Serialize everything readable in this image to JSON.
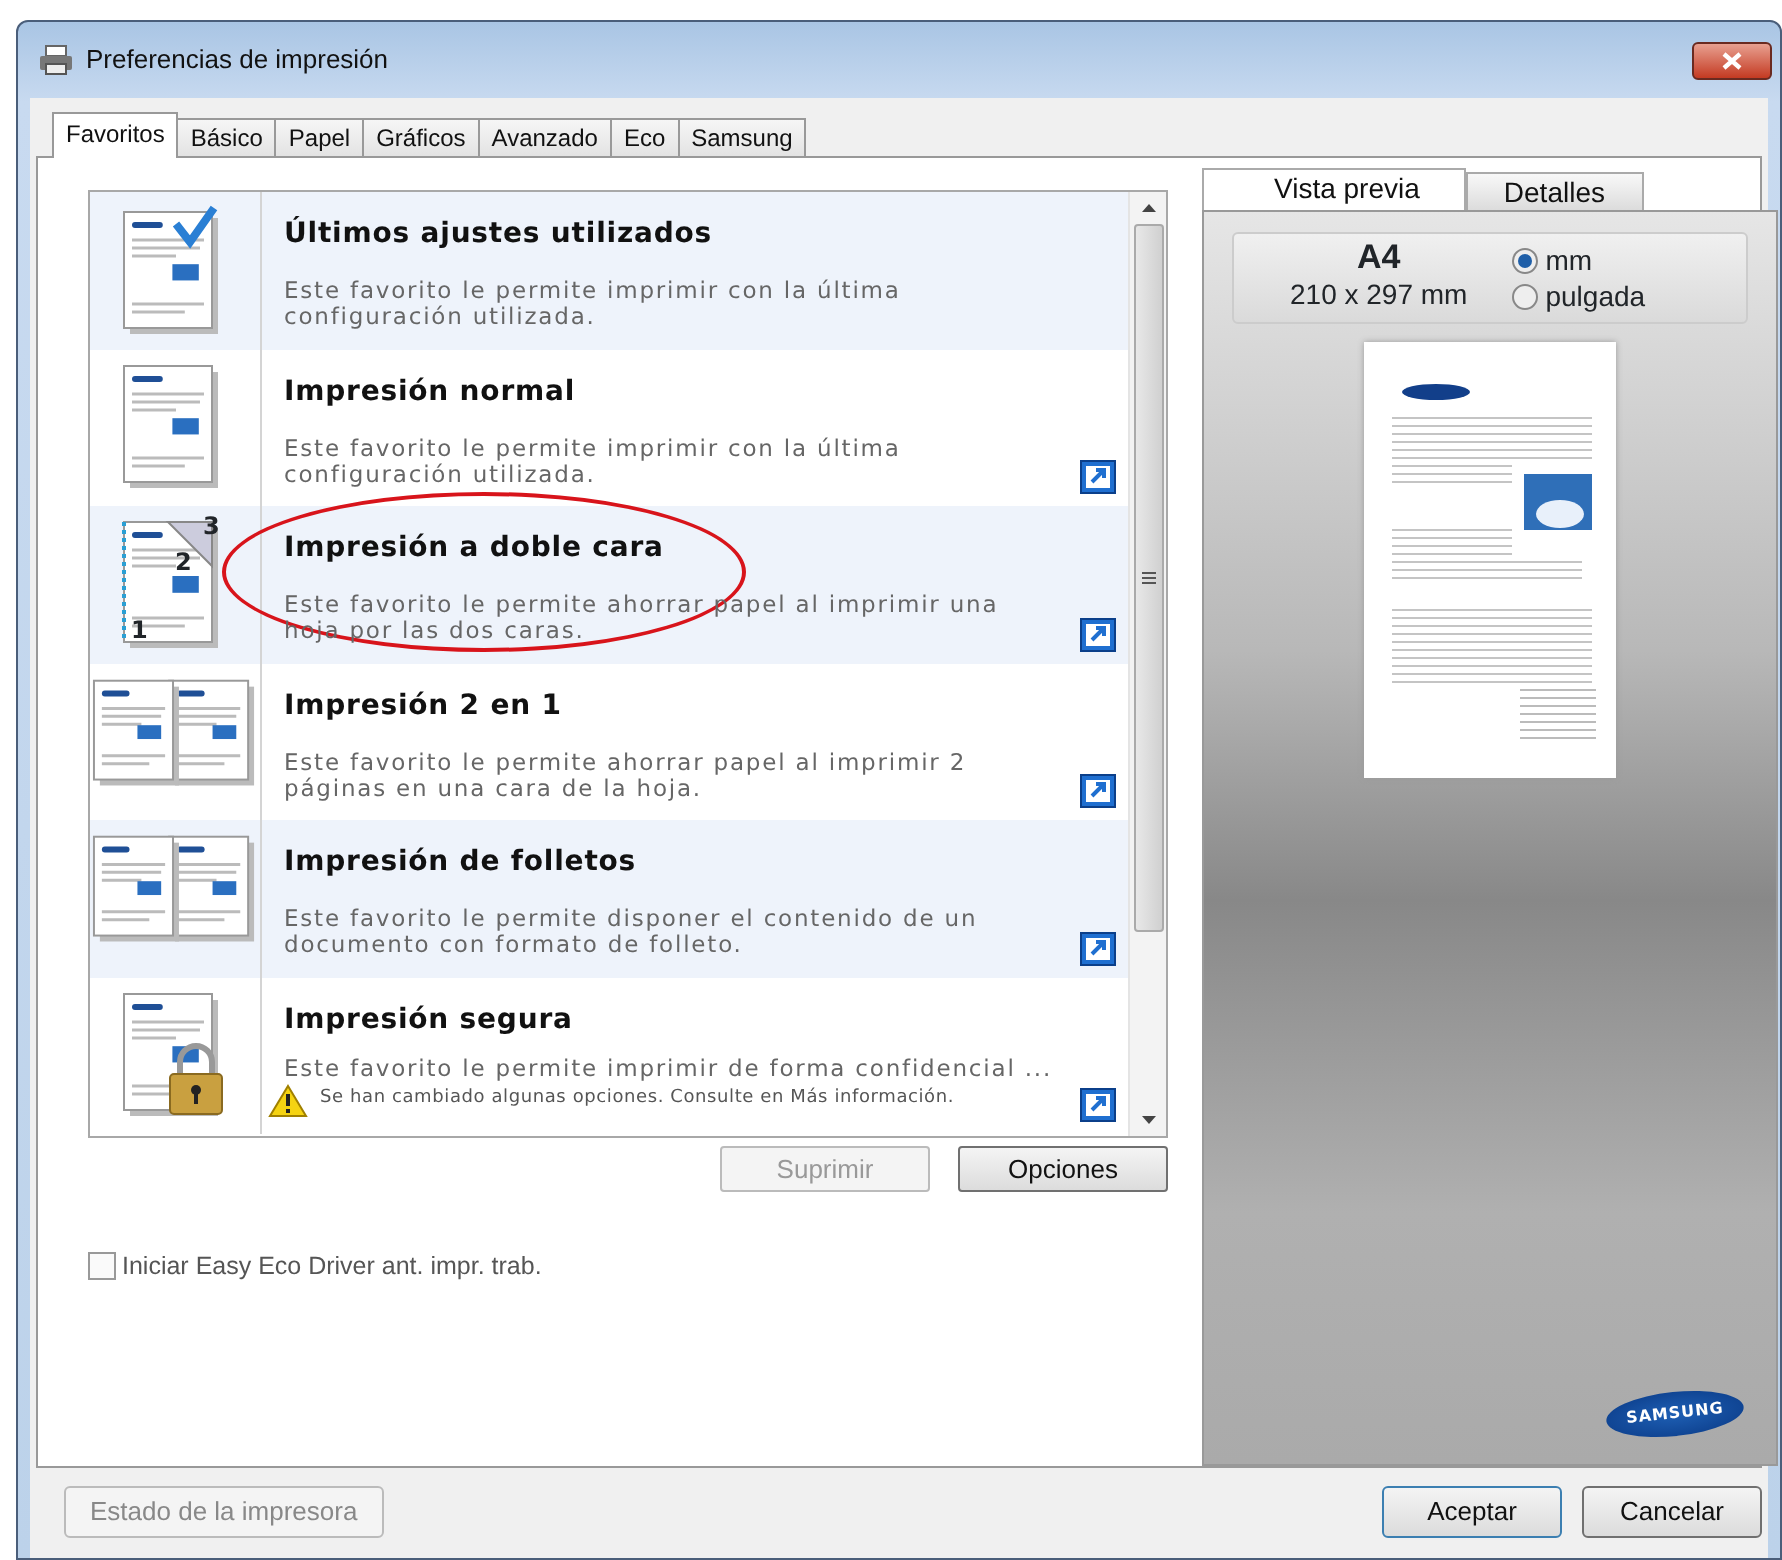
{
  "window": {
    "title": "Preferencias de impresión"
  },
  "tabs": [
    {
      "label": "Favoritos",
      "selected": true
    },
    {
      "label": "Básico",
      "selected": false
    },
    {
      "label": "Papel",
      "selected": false
    },
    {
      "label": "Gráficos",
      "selected": false
    },
    {
      "label": "Avanzado",
      "selected": false
    },
    {
      "label": "Eco",
      "selected": false
    },
    {
      "label": "Samsung",
      "selected": false
    }
  ],
  "favorites": [
    {
      "kind": "check",
      "title": "Últimos ajustes utilizados",
      "description": "Este favorito le permite imprimir con la última configuración utilizada.",
      "linked": false,
      "circled": false
    },
    {
      "kind": "page",
      "title": "Impresión normal",
      "description": "Este favorito le permite imprimir con la última configuración utilizada.",
      "linked": true,
      "circled": false
    },
    {
      "kind": "duplex",
      "title": "Impresión a doble cara",
      "description": "Este favorito le permite ahorrar papel al imprimir una hoja por las dos caras.",
      "linked": true,
      "circled": true,
      "page_numbers": [
        "3",
        "2",
        "1"
      ]
    },
    {
      "kind": "two-up",
      "title": "Impresión 2 en 1",
      "description": "Este favorito le permite ahorrar papel al imprimir 2 páginas en una cara de la hoja.",
      "linked": true,
      "circled": false
    },
    {
      "kind": "booklet",
      "title": "Impresión de folletos",
      "description": "Este favorito le permite disponer el contenido de un documento con formato de folleto.",
      "linked": true,
      "circled": false
    },
    {
      "kind": "lock",
      "title": "Impresión segura",
      "description": "Este favorito le permite imprimir de forma confidencial ...",
      "warning": "Se han cambiado algunas opciones. Consulte en Más información.",
      "linked": true,
      "circled": false
    }
  ],
  "list_buttons": [
    {
      "label": "Suprimir",
      "disabled": true
    },
    {
      "label": "Opciones",
      "disabled": false
    }
  ],
  "eco_checkbox": {
    "label": "Iniciar Easy Eco Driver ant. impr. trab.",
    "checked": false
  },
  "preview_tabs": [
    {
      "label": "Vista previa",
      "selected": true
    },
    {
      "label": "Detalles",
      "selected": false
    }
  ],
  "paper": {
    "name": "A4",
    "size": "210 x 297 mm"
  },
  "units": [
    {
      "label": "mm",
      "selected": true
    },
    {
      "label": "pulgada",
      "selected": false
    }
  ],
  "brand_logo": "SAMSUNG",
  "footer_buttons": [
    {
      "label": "Estado de la impresora",
      "disabled": true,
      "kind": "left"
    },
    {
      "label": "Aceptar",
      "disabled": false,
      "kind": "right"
    },
    {
      "label": "Cancelar",
      "disabled": false,
      "kind": "right"
    }
  ]
}
